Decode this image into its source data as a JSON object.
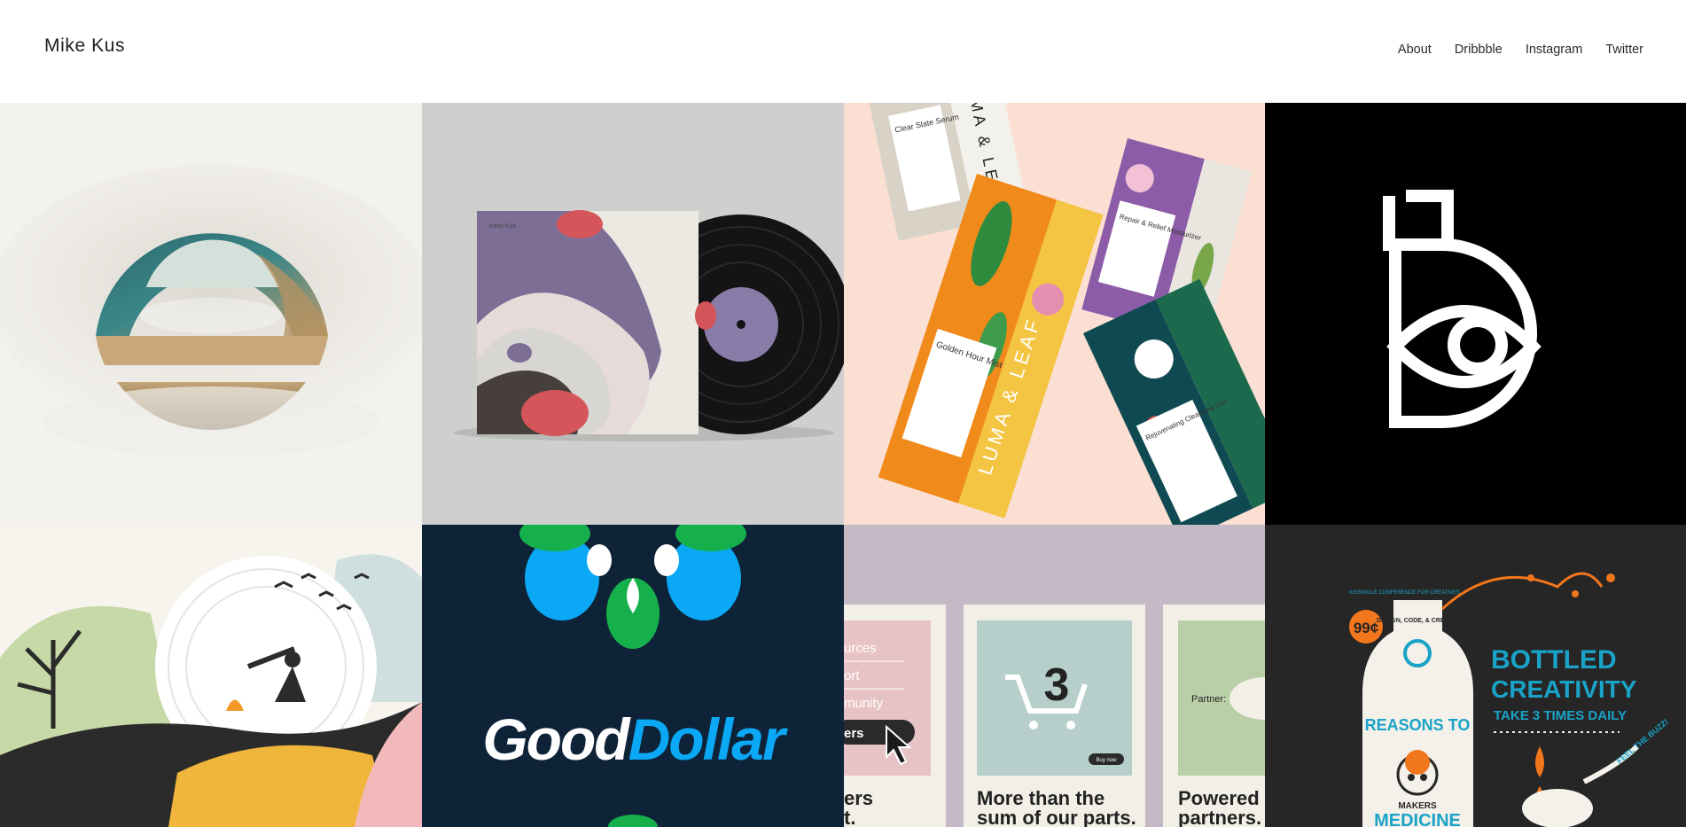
{
  "header": {
    "brand": "Mike Kus",
    "nav": [
      "About",
      "Dribbble",
      "Instagram",
      "Twitter"
    ]
  },
  "portfolio": {
    "vinyl": {
      "cover_text": "Kany Kus"
    },
    "packaging": {
      "brand": "LUMA & LEAF",
      "box_labels": [
        "Clear Slate Serum",
        "Golden Hour Mist",
        "Repair & Relief Moisturizer",
        "Rejuvenating Cleansing Gel"
      ]
    },
    "gooddollar": {
      "logo_left": "Good",
      "logo_right": "Dollar"
    },
    "cards": {
      "list_items": [
        "urces",
        "ort",
        "munity",
        "ers"
      ],
      "cart_count": "3",
      "buy_button": "Buy now",
      "partner_label": "Partner:",
      "card1_caption": [
        "ers",
        "t."
      ],
      "card2_caption": [
        "More than the",
        "sum of our parts."
      ],
      "card3_caption": [
        "Powered b",
        "partners."
      ]
    },
    "poster": {
      "badge": "99¢",
      "top_small": "KISSINGLE CONFERENCE FOR CREATIVES",
      "bottle_text": "DESIGN, CODE, & CREATE.",
      "headline": [
        "BOTTLED",
        "CREATIVITY"
      ],
      "subline": "TAKE 3 TIMES DAILY",
      "buzz": "FEEL THE BUZZ!",
      "reasons": "REASONS TO",
      "makers": "MAKERS",
      "medicine": "MEDICINE"
    }
  },
  "colors": {
    "accent_blue": "#0aa8f5",
    "navy": "#0e2238",
    "poster_teal": "#1aa3c8",
    "poster_orange": "#f2761b"
  }
}
